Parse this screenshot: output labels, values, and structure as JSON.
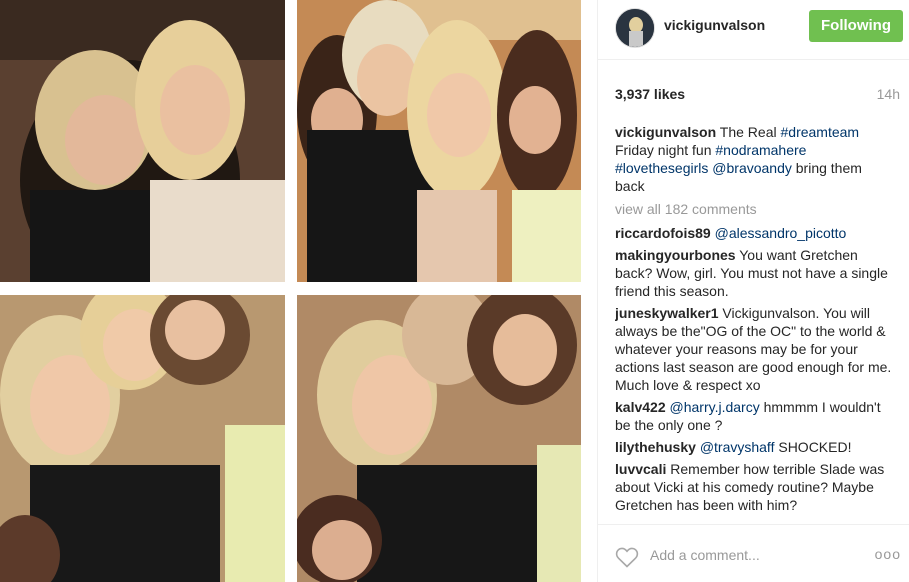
{
  "post": {
    "username": "vickigunvalson",
    "follow_label": "Following",
    "likes": "3,937 likes",
    "time_ago": "14h",
    "view_all": "view all 182 comments",
    "add_comment_placeholder": "Add a comment...",
    "more_label": "ooo"
  },
  "caption": {
    "user": "vickigunvalson",
    "text1": "The Real ",
    "tag1": "#dreamteam",
    "text2": " Friday night fun ",
    "tag2": "#nodramahere",
    "tag3": "#lovethesegirls",
    "tag4": "@bravoandy",
    "text3": " bring them back"
  },
  "comments": [
    {
      "user": "riccardofois89",
      "tag": "@alessandro_picotto",
      "text": ""
    },
    {
      "user": "makingyourbones",
      "tag": "",
      "text": "You want Gretchen back? Wow, girl. You must not have a single friend this season."
    },
    {
      "user": "juneskywalker1",
      "tag": "",
      "text": "Vickigunvalson. You will always be the\"OG of the OC\" to the world & whatever your reasons may be for your actions last season are good enough for me. Much love & respect xo"
    },
    {
      "user": "kalv422",
      "tag": "@harry.j.darcy",
      "text": " hmmmm I wouldn't be the only one ?"
    },
    {
      "user": "lilythehusky",
      "tag": "@travyshaff",
      "text": " SHOCKED!"
    },
    {
      "user": "luvvcali",
      "tag": "",
      "text": "Remember how terrible Slade was about Vicki at his comedy routine? Maybe Gretchen has been with him?"
    }
  ],
  "colors": {
    "follow_bg": "#70c050",
    "link": "#003569",
    "muted": "#999999"
  }
}
